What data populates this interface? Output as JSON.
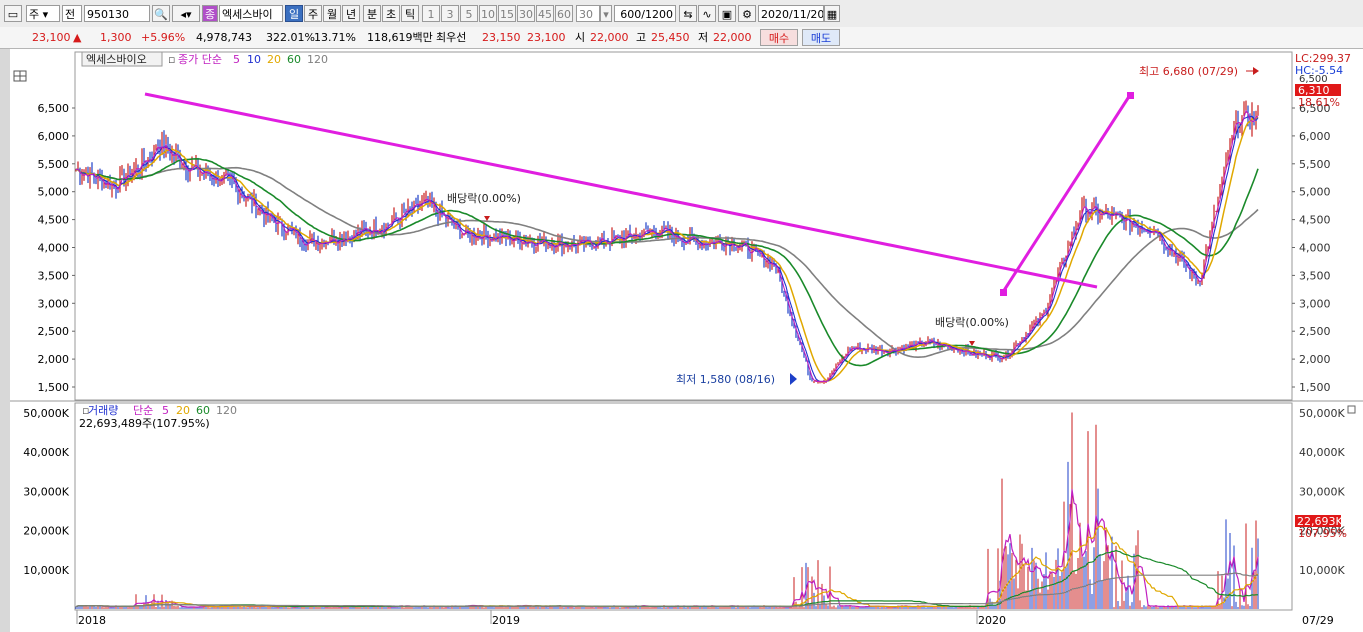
{
  "toolbar": {
    "period_label": "주",
    "market_label": "전",
    "code": "950130",
    "stock_badge": "종",
    "stock_name": "엑세스바이",
    "tabs": [
      "일",
      "주",
      "월",
      "년",
      "분",
      "초",
      "틱"
    ],
    "interval_buttons": [
      "1",
      "3",
      "5",
      "10",
      "15",
      "30",
      "45",
      "60"
    ],
    "interval_input": "30",
    "count": "600",
    "count_total": "/1200",
    "date": "2020/11/20"
  },
  "quote": {
    "price": "23,100",
    "change_arrow": "▲",
    "change": "1,300",
    "change_pct": "+5.96%",
    "volume": "4,978,743",
    "vol_ratio": "322.01%",
    "turnover": "13.71%",
    "amount": "118,619백만",
    "best_ask_label": "최우선",
    "best_ask": "23,150",
    "best_bid": "23,100",
    "open_label": "시",
    "open": "22,000",
    "high_label": "고",
    "high": "25,450",
    "low_label": "저",
    "low": "22,000",
    "buy_label": "매수",
    "sell_label": "매도"
  },
  "colors": {
    "ma5": "#c01fc0",
    "ma10": "#2030d0",
    "ma20": "#e0a800",
    "ma60": "#1a8a2a",
    "ma120": "#808080",
    "up": "#c81d1d",
    "down": "#1d3fc8",
    "trend": "#e01ee0"
  },
  "chart_data": [
    {
      "type": "line",
      "title": "엑세스바이오",
      "legend": {
        "label": "종가 단순",
        "periods": [
          "5",
          "10",
          "20",
          "60",
          "120"
        ]
      },
      "x_ticks": [
        "2018",
        "2019",
        "2020"
      ],
      "x_last_label": "07/29",
      "y_ticks": [
        "1,500",
        "2,000",
        "2,500",
        "3,000",
        "3,500",
        "4,000",
        "4,500",
        "5,000",
        "5,500",
        "6,000",
        "6,500"
      ],
      "ylim": [
        1350,
        6850
      ],
      "series": [
        {
          "name": "종가",
          "x": [
            "2018-01",
            "2018-03",
            "2018-05",
            "2018-07",
            "2018-09",
            "2018-11",
            "2019-01",
            "2019-03",
            "2019-05",
            "2019-07",
            "2019-08",
            "2019-10",
            "2019-12",
            "2020-01",
            "2020-03",
            "2020-05",
            "2020-06",
            "2020-07"
          ],
          "values": [
            5400,
            5700,
            5150,
            4100,
            4400,
            4250,
            4100,
            4150,
            4100,
            3700,
            1600,
            2150,
            2150,
            2050,
            4700,
            4300,
            3400,
            6310
          ]
        }
      ],
      "annotations": {
        "high": "최고 6,680 (07/29)",
        "low": "최저 1,580 (08/16)",
        "dividend1": "배당락(0.00%)",
        "dividend2": "배당락(0.00%)"
      },
      "right_labels": {
        "lc": "LC:299.37",
        "hc": "HC:-5.54",
        "top_value": "6,500",
        "price_tag": "6,310",
        "pct": "18.61%"
      }
    },
    {
      "type": "bar",
      "title": "거래량",
      "legend": {
        "label": "단순",
        "periods": [
          "5",
          "20",
          "60",
          "120"
        ]
      },
      "y_ticks": [
        "10,000K",
        "20,000K",
        "30,000K",
        "40,000K",
        "50,000K"
      ],
      "ylim": [
        0,
        52000
      ],
      "value_line": "22,693,489주(107.95%)",
      "price_tag": "22,693K",
      "pct": "107.95%",
      "peaks": {
        "2018-03": 4000,
        "2019-08": 12000,
        "2020-01": 18000,
        "2020-03": 49000,
        "2020-04": 27000,
        "2020-07": 22693
      }
    }
  ]
}
